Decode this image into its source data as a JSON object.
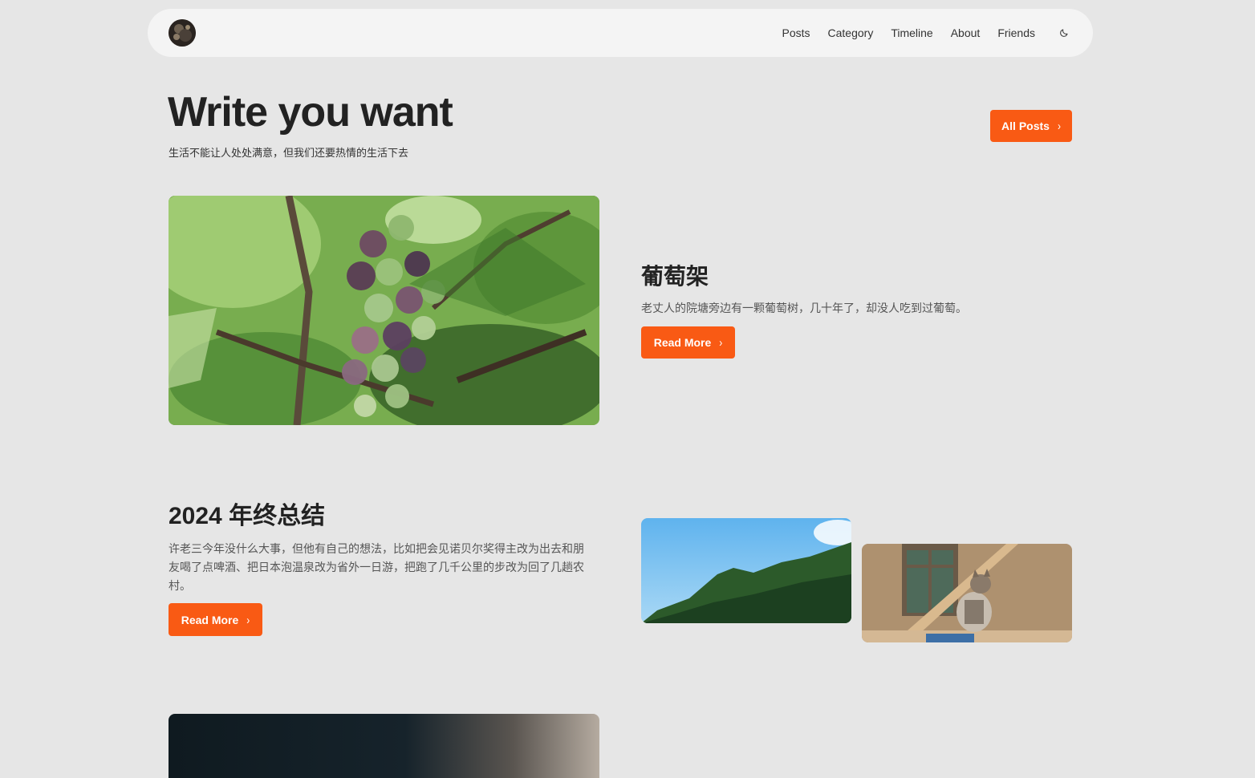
{
  "nav": {
    "links": [
      "Posts",
      "Category",
      "Timeline",
      "About",
      "Friends"
    ],
    "theme_icon": "moon-icon"
  },
  "hero": {
    "title": "Write you want",
    "subtitle": "生活不能让人处处满意，但我们还要热情的生活下去",
    "all_posts_label": "All Posts"
  },
  "posts": [
    {
      "title": "葡萄架",
      "excerpt": "老丈人的院塘旁边有一颗葡萄树，几十年了，却没人吃到过葡萄。",
      "read_more": "Read More",
      "image": "grapes-photo"
    },
    {
      "title": "2024 年终总结",
      "excerpt": "许老三今年没什么大事，但他有自己的想法，比如把会见诺贝尔奖得主改为出去和朋友喝了点啤酒、把日本泡温泉改为省外一日游，把跑了几千公里的步改为回了几趟农村。",
      "read_more": "Read More",
      "images": [
        "mountain-photo",
        "cat-photo"
      ]
    },
    {
      "image": "dark-photo"
    }
  ],
  "colors": {
    "accent": "#f95a14",
    "background": "#e6e6e6",
    "navbar": "#f4f4f4"
  }
}
